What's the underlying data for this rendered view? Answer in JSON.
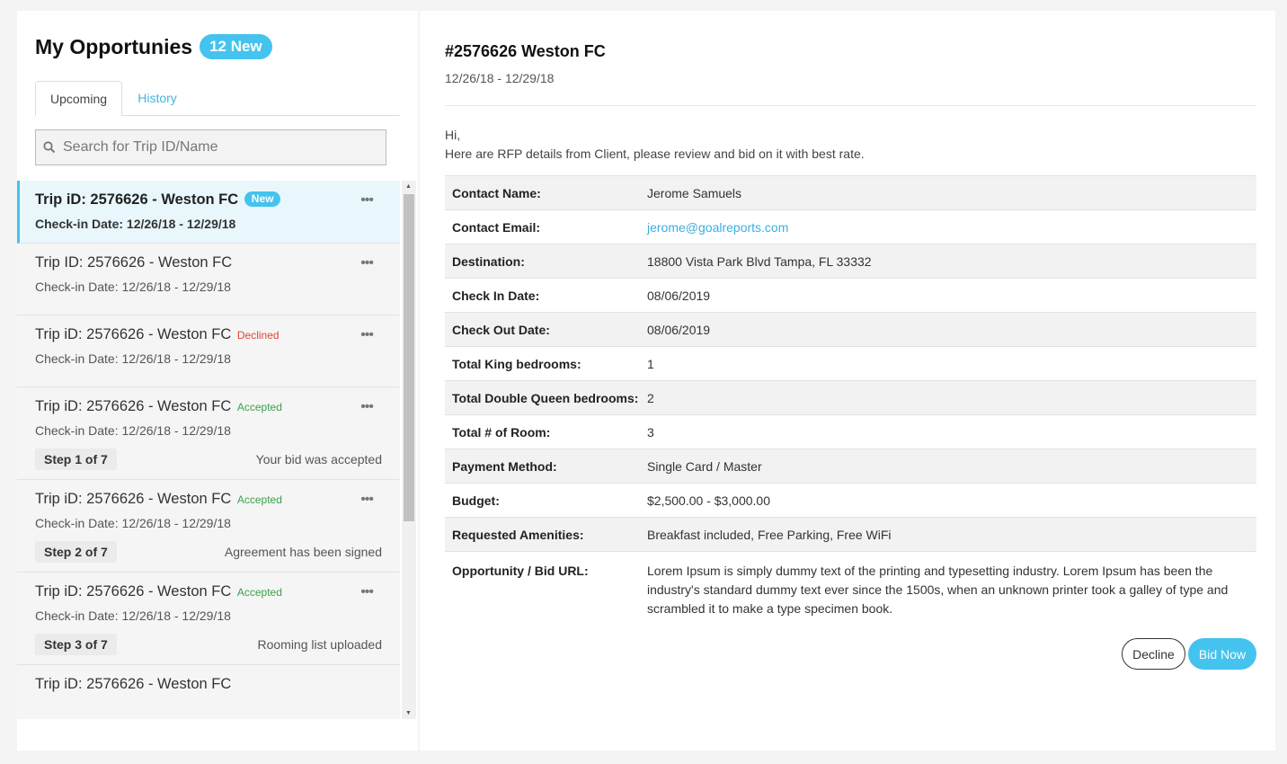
{
  "header": {
    "title": "My Opportunies",
    "new_badge": "12 New"
  },
  "tabs": [
    {
      "label": "Upcoming"
    },
    {
      "label": "History"
    }
  ],
  "search": {
    "placeholder": "Search for Trip ID/Name",
    "value": ""
  },
  "icons": {
    "search": "search-icon",
    "more": "more-options-icon",
    "scroll_up": "scroll-up-icon",
    "scroll_down": "scroll-down-icon"
  },
  "colors": {
    "accent": "#44c3ee",
    "declined": "#e0453b",
    "accepted": "#3aa34a",
    "link": "#3aaee0"
  },
  "trips": [
    {
      "title": "Trip iD: 2576626 - Weston FC",
      "status": "New",
      "date": "Check-in Date: 12/26/18 - 12/29/18"
    },
    {
      "title": "Trip ID: 2576626 - Weston FC",
      "status": "",
      "date": "Check-in Date: 12/26/18 - 12/29/18"
    },
    {
      "title": "Trip iD: 2576626 - Weston FC",
      "status": "Declined",
      "date": "Check-in Date: 12/26/18 - 12/29/18"
    },
    {
      "title": "Trip iD: 2576626 - Weston FC",
      "status": "Accepted",
      "date": "Check-in Date: 12/26/18 - 12/29/18",
      "step": "Step 1 of 7",
      "step_text": "Your bid was accepted"
    },
    {
      "title": "Trip iD: 2576626 - Weston FC",
      "status": "Accepted",
      "date": "Check-in Date: 12/26/18 - 12/29/18",
      "step": "Step 2 of 7",
      "step_text": "Agreement has been signed"
    },
    {
      "title": "Trip iD: 2576626 - Weston FC",
      "status": "Accepted",
      "date": "Check-in Date: 12/26/18 - 12/29/18",
      "step": "Step 3 of 7",
      "step_text": "Rooming list uploaded"
    },
    {
      "title": "Trip iD: 2576626 - Weston FC",
      "status": "",
      "date": ""
    }
  ],
  "detail": {
    "title": "#2576626 Weston FC",
    "dates": "12/26/18 - 12/29/18",
    "greeting": "Hi,",
    "intro": "Here are RFP details from Client, please review and bid on it with best rate.",
    "rows": [
      {
        "key": "Contact Name:",
        "value": "Jerome Samuels"
      },
      {
        "key": "Contact Email:",
        "value": "jerome@goalreports.com"
      },
      {
        "key": "Destination:",
        "value": "18800 Vista Park Blvd Tampa, FL 33332"
      },
      {
        "key": "Check In Date:",
        "value": "08/06/2019"
      },
      {
        "key": "Check Out Date:",
        "value": "08/06/2019"
      },
      {
        "key": "Total King bedrooms:",
        "value": "1"
      },
      {
        "key": "Total Double Queen bedrooms:",
        "value": "2"
      },
      {
        "key": "Total # of Room:",
        "value": "3"
      },
      {
        "key": "Payment Method:",
        "value": "Single Card / Master"
      },
      {
        "key": "Budget:",
        "value": "$2,500.00 - $3,000.00"
      },
      {
        "key": "Requested Amenities:",
        "value": "Breakfast included, Free Parking, Free WiFi"
      },
      {
        "key": "Opportunity / Bid URL:",
        "value": "Lorem Ipsum is simply dummy text of the printing and typesetting industry. Lorem Ipsum has been the industry's standard dummy text ever since the 1500s, when an unknown printer took a galley of type and scrambled it to make a type specimen book."
      }
    ],
    "decline_label": "Decline",
    "bid_label": "Bid Now"
  }
}
